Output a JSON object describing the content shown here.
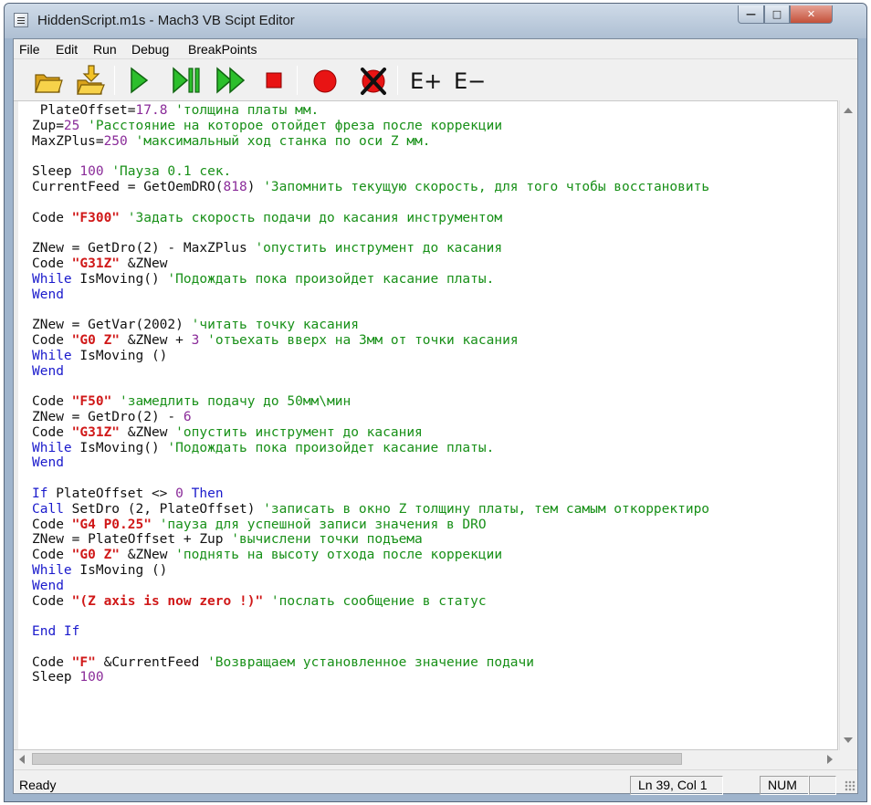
{
  "window": {
    "title": "HiddenScript.m1s - Mach3 VB Scipt Editor",
    "controls": {
      "minimize": "—",
      "maximize": "□",
      "close": "✕"
    }
  },
  "menu": [
    "File",
    "Edit",
    "Run",
    "Debug",
    "BreakPoints"
  ],
  "toolbar": {
    "icons": [
      "open-folder-icon",
      "save-icon",
      "run-icon",
      "step-icon",
      "step-over-icon",
      "stop-icon",
      "breakpoint-icon",
      "clear-breakpoint-icon",
      "expand-icon",
      "collapse-icon"
    ],
    "expand_label": "E+",
    "collapse_label": "E−"
  },
  "colors": {
    "keyword": "#1a1acc",
    "number": "#8a2b99",
    "string": "#d01818",
    "comment": "#189018",
    "run_green": "#22b022",
    "stop_red": "#e01010"
  },
  "code": [
    [
      {
        "t": "plain",
        "v": " PlateOffset="
      },
      {
        "t": "num",
        "v": "17.8"
      },
      {
        "t": "plain",
        "v": " "
      },
      {
        "t": "cm",
        "v": "'толщина платы мм."
      }
    ],
    [
      {
        "t": "plain",
        "v": "Zup="
      },
      {
        "t": "num",
        "v": "25"
      },
      {
        "t": "plain",
        "v": " "
      },
      {
        "t": "cm",
        "v": "'Расстояние на которое отойдет фреза после коррекции"
      }
    ],
    [
      {
        "t": "plain",
        "v": "MaxZPlus="
      },
      {
        "t": "num",
        "v": "250"
      },
      {
        "t": "plain",
        "v": " "
      },
      {
        "t": "cm",
        "v": "'максимальный ход станка по оси Z мм."
      }
    ],
    [],
    [
      {
        "t": "plain",
        "v": "Sleep "
      },
      {
        "t": "num",
        "v": "100"
      },
      {
        "t": "plain",
        "v": " "
      },
      {
        "t": "cm",
        "v": "'Пауза 0.1 сек."
      }
    ],
    [
      {
        "t": "plain",
        "v": "CurrentFeed = GetOemDRO("
      },
      {
        "t": "num",
        "v": "818"
      },
      {
        "t": "plain",
        "v": ") "
      },
      {
        "t": "cm",
        "v": "'Запомнить текущую скорость, для того чтобы восстановить"
      }
    ],
    [],
    [
      {
        "t": "plain",
        "v": "Code "
      },
      {
        "t": "str",
        "v": "\"F300\""
      },
      {
        "t": "plain",
        "v": " "
      },
      {
        "t": "cm",
        "v": "'Задать скорость подачи до касания инструментом"
      }
    ],
    [],
    [
      {
        "t": "plain",
        "v": "ZNew = GetDro(2) - MaxZPlus "
      },
      {
        "t": "cm",
        "v": "'опустить инструмент до касания"
      }
    ],
    [
      {
        "t": "plain",
        "v": "Code "
      },
      {
        "t": "str",
        "v": "\"G31Z\""
      },
      {
        "t": "plain",
        "v": " &ZNew"
      }
    ],
    [
      {
        "t": "kw",
        "v": "While"
      },
      {
        "t": "plain",
        "v": " IsMoving() "
      },
      {
        "t": "cm",
        "v": "'Подождать пока произойдет касание платы."
      }
    ],
    [
      {
        "t": "kw",
        "v": "Wend"
      }
    ],
    [],
    [
      {
        "t": "plain",
        "v": "ZNew = GetVar(2002) "
      },
      {
        "t": "cm",
        "v": "'читать точку касания"
      }
    ],
    [
      {
        "t": "plain",
        "v": "Code "
      },
      {
        "t": "str",
        "v": "\"G0 Z\""
      },
      {
        "t": "plain",
        "v": " &ZNew + "
      },
      {
        "t": "num",
        "v": "3"
      },
      {
        "t": "plain",
        "v": " "
      },
      {
        "t": "cm",
        "v": "'отъехать вверх на 3мм от точки касания"
      }
    ],
    [
      {
        "t": "kw",
        "v": "While"
      },
      {
        "t": "plain",
        "v": " IsMoving ()"
      }
    ],
    [
      {
        "t": "kw",
        "v": "Wend"
      }
    ],
    [],
    [
      {
        "t": "plain",
        "v": "Code "
      },
      {
        "t": "str",
        "v": "\"F50\""
      },
      {
        "t": "plain",
        "v": " "
      },
      {
        "t": "cm",
        "v": "'замедлить подачу до 50мм\\мин"
      }
    ],
    [
      {
        "t": "plain",
        "v": "ZNew = GetDro(2) - "
      },
      {
        "t": "num",
        "v": "6"
      }
    ],
    [
      {
        "t": "plain",
        "v": "Code "
      },
      {
        "t": "str",
        "v": "\"G31Z\""
      },
      {
        "t": "plain",
        "v": " &ZNew "
      },
      {
        "t": "cm",
        "v": "'опустить инструмент до касания"
      }
    ],
    [
      {
        "t": "kw",
        "v": "While"
      },
      {
        "t": "plain",
        "v": " IsMoving() "
      },
      {
        "t": "cm",
        "v": "'Подождать пока произойдет касание платы."
      }
    ],
    [
      {
        "t": "kw",
        "v": "Wend"
      }
    ],
    [],
    [
      {
        "t": "kw",
        "v": "If"
      },
      {
        "t": "plain",
        "v": " PlateOffset <> "
      },
      {
        "t": "num",
        "v": "0"
      },
      {
        "t": "plain",
        "v": " "
      },
      {
        "t": "kw",
        "v": "Then"
      }
    ],
    [
      {
        "t": "kw",
        "v": "Call"
      },
      {
        "t": "plain",
        "v": " SetDro (2, PlateOffset) "
      },
      {
        "t": "cm",
        "v": "'записать в окно Z толщину платы, тем самым откорректиро"
      }
    ],
    [
      {
        "t": "plain",
        "v": "Code "
      },
      {
        "t": "str",
        "v": "\"G4 P0.25\""
      },
      {
        "t": "plain",
        "v": " "
      },
      {
        "t": "cm",
        "v": "'пауза для успешной записи значения в DRO"
      }
    ],
    [
      {
        "t": "plain",
        "v": "ZNew = PlateOffset + Zup "
      },
      {
        "t": "cm",
        "v": "'вычислени точки подъема"
      }
    ],
    [
      {
        "t": "plain",
        "v": "Code "
      },
      {
        "t": "str",
        "v": "\"G0 Z\""
      },
      {
        "t": "plain",
        "v": " &ZNew "
      },
      {
        "t": "cm",
        "v": "'поднять на высоту отхода после коррекции"
      }
    ],
    [
      {
        "t": "kw",
        "v": "While"
      },
      {
        "t": "plain",
        "v": " IsMoving ()"
      }
    ],
    [
      {
        "t": "kw",
        "v": "Wend"
      }
    ],
    [
      {
        "t": "plain",
        "v": "Code "
      },
      {
        "t": "str",
        "v": "\"(Z axis is now zero !)\""
      },
      {
        "t": "plain",
        "v": " "
      },
      {
        "t": "cm",
        "v": "'послать сообщение в статус"
      }
    ],
    [],
    [
      {
        "t": "kw",
        "v": "End If"
      }
    ],
    [],
    [
      {
        "t": "plain",
        "v": "Code "
      },
      {
        "t": "str",
        "v": "\"F\""
      },
      {
        "t": "plain",
        "v": " &CurrentFeed "
      },
      {
        "t": "cm",
        "v": "'Возвращаем установленное значение подачи"
      }
    ],
    [
      {
        "t": "plain",
        "v": "Sleep "
      },
      {
        "t": "num",
        "v": "100"
      }
    ]
  ],
  "status": {
    "text": "Ready",
    "position": "Ln 39, Col 1",
    "numlock": "NUM",
    "extra": ""
  }
}
